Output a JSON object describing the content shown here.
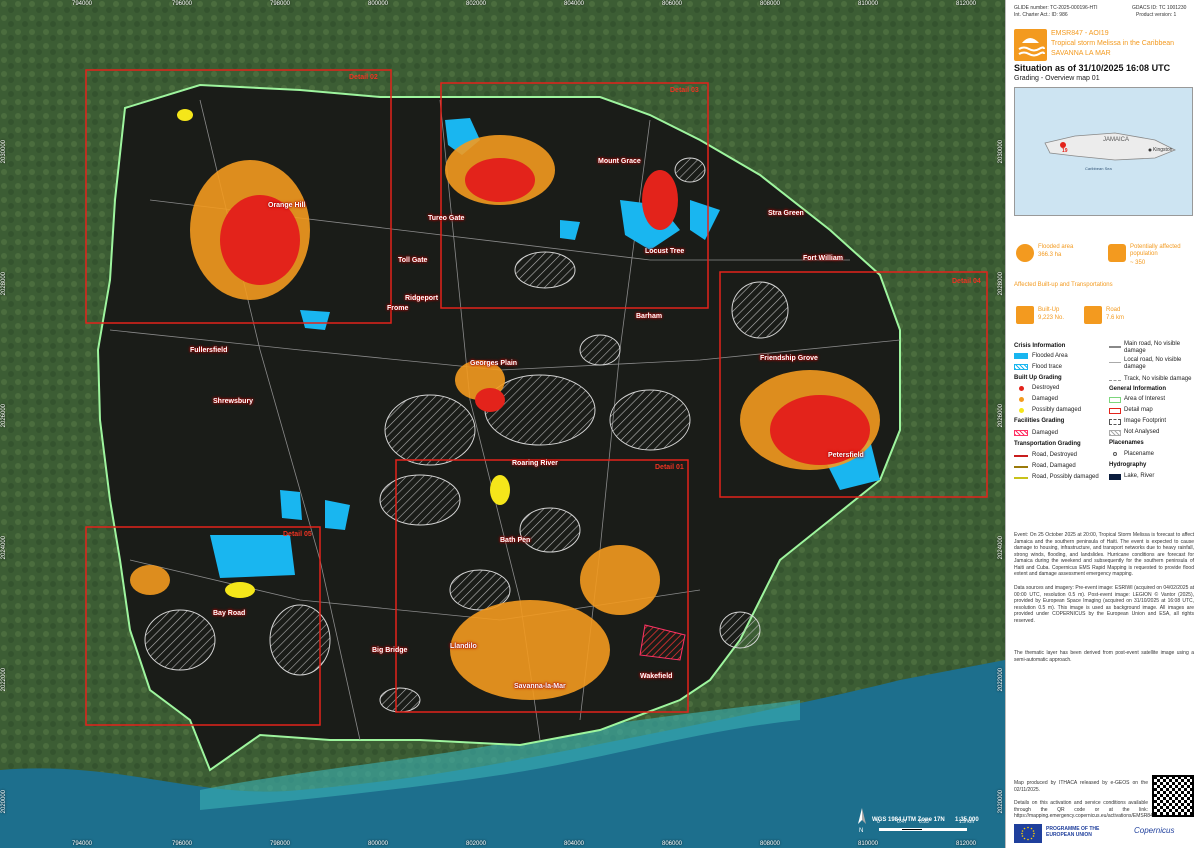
{
  "map": {
    "coords_top": [
      "794000",
      "796000",
      "798000",
      "800000",
      "802000",
      "804000",
      "806000",
      "808000",
      "810000",
      "812000"
    ],
    "coords_bottom": [
      "794000",
      "796000",
      "798000",
      "800000",
      "802000",
      "804000",
      "806000",
      "808000",
      "810000",
      "812000"
    ],
    "coords_left": [
      "2030000",
      "2028000",
      "2026000",
      "2024000",
      "2022000",
      "2020000"
    ],
    "coords_right": [
      "2030000",
      "2028000",
      "2026000",
      "2024000",
      "2022000",
      "2020000"
    ],
    "places": [
      {
        "name": "Orange Hill"
      },
      {
        "name": "Tureo Gate"
      },
      {
        "name": "Toll Gate"
      },
      {
        "name": "Mount Grace"
      },
      {
        "name": "Stra Green"
      },
      {
        "name": "Locust Tree"
      },
      {
        "name": "Fort William"
      },
      {
        "name": "Ridgeport"
      },
      {
        "name": "Frome"
      },
      {
        "name": "Fullersfield"
      },
      {
        "name": "Barham"
      },
      {
        "name": "Georges Plain"
      },
      {
        "name": "Friendship Grove"
      },
      {
        "name": "Petersfield"
      },
      {
        "name": "Roaring River"
      },
      {
        "name": "Bath Pen"
      },
      {
        "name": "Big Bridge"
      },
      {
        "name": "Llandilo"
      },
      {
        "name": "Savanna-la-Mar"
      },
      {
        "name": "Bay Road"
      },
      {
        "name": "Wakefield"
      },
      {
        "name": "Shrewsbury"
      }
    ],
    "details": [
      {
        "label": "Detail 02"
      },
      {
        "label": "Detail 03"
      },
      {
        "label": "Detail 04"
      },
      {
        "label": "Detail 01"
      },
      {
        "label": "Detail 05"
      }
    ],
    "scale": {
      "ticks": [
        "0",
        "0.47",
        "0.95",
        "1.9 km"
      ],
      "projection": "WGS 1984 UTM Zone 17N",
      "ratio": "1:35,000"
    }
  },
  "panel": {
    "glide": "GLIDE number: TC-2025-000196-HTI",
    "charter": "Int. Charter Act.: ID: 986",
    "gdacs": "GDACS ID: TC 1001230",
    "version": "Product version: 1",
    "ems_code": "EMSR847 - AOI19",
    "event": "Tropical storm Melissa in the Caribbean",
    "aoi_name": "SAVANNA LA MAR",
    "situation": "Situation as of 31/10/2025 16:08 UTC",
    "subtitle": "Grading - Overview map 01",
    "inset": {
      "country": "JAMAICA",
      "city": "Kingston",
      "sea": "Caribbean Sea",
      "aoi_num": "19"
    },
    "flooded_label": "Flooded area",
    "flooded_value": "366.3 ha",
    "population_label": "Potentially affected population",
    "population_value": "~ 350",
    "affected_title": "Affected Built-up and Transportations",
    "builtup_label": "Built-Up",
    "builtup_value": "9,223 No.",
    "road_label": "Road",
    "road_value": "7.6 km",
    "legend": {
      "crisis_title": "Crisis Information",
      "flooded_area": "Flooded Area",
      "flood_trace": "Flood trace",
      "builtup_title": "Built Up Grading",
      "destroyed": "Destroyed",
      "damaged": "Damaged",
      "possibly": "Possibly damaged",
      "facilities_title": "Facilities Grading",
      "fac_damaged": "Damaged",
      "transport_title": "Transportation Grading",
      "road_destroyed": "Road, Destroyed",
      "road_damaged": "Road, Damaged",
      "road_possibly": "Road, Possibly damaged",
      "main_road": "Main road, No visible damage",
      "local_road": "Local road, No visible damage",
      "track": "Track, No visible damage",
      "general_title": "General Information",
      "aoi": "Area of Interest",
      "detail_map": "Detail map",
      "footprint": "Image Footprint",
      "not_analysed": "Not Analysed",
      "placenames_title": "Placenames",
      "placename": "Placename",
      "hydro_title": "Hydrography",
      "lake_river": "Lake, River"
    },
    "event_text": "Event: On 25 October 2025 at 20:00, Tropical Storm Melissa is forecast to affect Jamaica and the southern peninsula of Haiti. The event is expected to cause damage to housing, infrastructure, and transport networks due to heavy rainfall, strong winds, flooding, and landslides. Hurricane conditions are forecast for Jamaica during the weekend and subsequently for the southern peninsula of Haiti and Cuba. Copernicus EMS Rapid Mapping is requested to provide flood extent and damage assessment emergency mapping.",
    "data_text": "Data sources and imagery: Pre-event image: ESRIWI (acquired on 04/02/2025 at 00:00 UTC, resolution 0.5 m). Post-event image: LEGION © Vantor (2025), provided by European Space Imaging (acquired on 31/10/2025 at 16:08 UTC, resolution 0.5 m). This image is used as background image. All images are provided under COPERNICUS by the European Union and ESA, all rights reserved.",
    "thematic_text": "The thematic layer has been derived from post-event satellite image using a semi-automatic approach.",
    "produced_text": "Map produced by ITHACA released by e-GEOS on the 02/11/2025.",
    "details_text": "Details on this activation and service conditions available through the QR code or at the link: https://mapping.emergency.copernicus.eu/activations/EMSR847",
    "eu_programme": "PROGRAMME OF THE EUROPEAN UNION",
    "copernicus": "Copernicus"
  },
  "colors": {
    "destroyed": "#e3231b",
    "damaged": "#f39a1f",
    "possibly": "#f5e61a",
    "flood": "#19b6f0",
    "aoi": "#7cd67c",
    "detail": "#e3231b",
    "brand": "#f39a1f"
  }
}
